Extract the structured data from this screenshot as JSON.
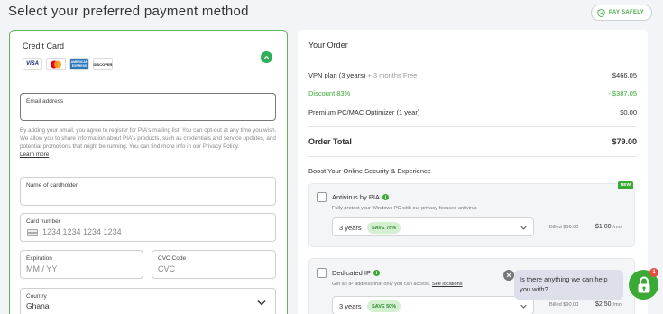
{
  "page": {
    "title": "Select your preferred payment method",
    "pay_safely": "PAY SAFELY"
  },
  "credit_card": {
    "title": "Credit Card",
    "logos": [
      "VISA",
      "Mastercard",
      "AMERICAN EXPRESS",
      "DISCOVER"
    ],
    "email": {
      "label": "Email address",
      "value": ""
    },
    "consent_text": "By adding your email, you agree to register for PIA's mailing list. You can opt-out at any time you wish. We allow you to share information about PIA's products, such as credentials and service updates, and potential promotions that might be running. You can find more info in our Privacy Policy.",
    "learn_more": "Learn more",
    "cardholder": {
      "label": "Name of cardholder",
      "value": ""
    },
    "card_number": {
      "label": "Card number",
      "placeholder": "1234 1234 1234 1234"
    },
    "expiration": {
      "label": "Expiration",
      "placeholder": "MM / YY"
    },
    "cvc": {
      "label": "CVC Code",
      "placeholder": "CVC"
    },
    "country": {
      "label": "Country",
      "value": "Ghana"
    }
  },
  "order": {
    "title": "Your Order",
    "lines": [
      {
        "label": "VPN plan (3 years)",
        "sub": " + 3 months Free",
        "amount": "$466.05"
      },
      {
        "label": "Discount 83%",
        "sub": "",
        "amount": "- $387.05"
      },
      {
        "label": "Premium PC/MAC Optimizer (1 year)",
        "sub": "",
        "amount": "$0.00"
      }
    ],
    "total_label": "Order Total",
    "total_amount": "$79.00",
    "boost_title": "Boost Your Online Security & Experience",
    "addons": [
      {
        "badge": "NEW",
        "name": "Antivirus by PIA",
        "desc": "Fully protect your Windows PC with our privacy-focused antivirus",
        "link": "",
        "term": "3 years",
        "save": "SAVE 78%",
        "billed": "Billed $36.00",
        "price": "$1.00",
        "per": "/mo."
      },
      {
        "badge": "",
        "name": "Dedicated IP",
        "desc": "Get an IP address that only you can access. ",
        "link": "See locations",
        "term": "3 years",
        "save": "SAVE 50%",
        "billed": "Billed $90.00",
        "price": "$2.50",
        "per": "/mo."
      }
    ]
  },
  "chat": {
    "message": "Is there anything we can help you with?",
    "badge": "1"
  },
  "colors": {
    "accent": "#3aaa35",
    "border_green": "#5cb85c",
    "background": "#f2f4f7"
  }
}
